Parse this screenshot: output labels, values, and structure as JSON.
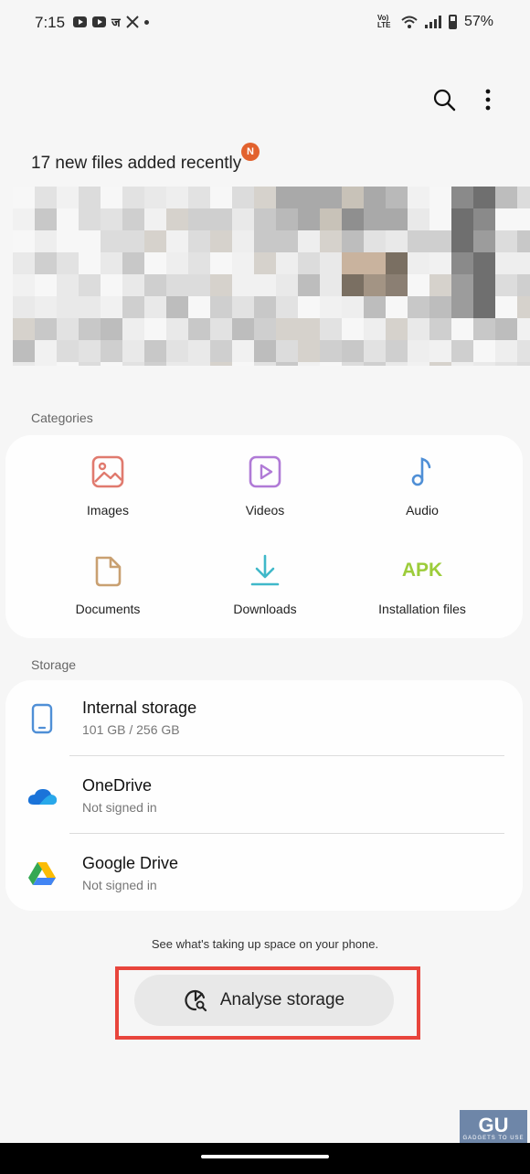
{
  "status_bar": {
    "time": "7:15",
    "battery": "57%",
    "network": "Vo) LTE",
    "app_indicator": "ज"
  },
  "toolbar": {
    "search_icon": "search-icon",
    "more_icon": "more-vertical-icon"
  },
  "recent": {
    "title": "17 new files added recently",
    "badge": "N"
  },
  "categories": {
    "label": "Categories",
    "items": [
      {
        "label": "Images",
        "icon": "image-icon",
        "color": "#e07a6e"
      },
      {
        "label": "Videos",
        "icon": "video-icon",
        "color": "#b07ad6"
      },
      {
        "label": "Audio",
        "icon": "music-note-icon",
        "color": "#4f8fd6"
      },
      {
        "label": "Documents",
        "icon": "document-icon",
        "color": "#c9a071"
      },
      {
        "label": "Downloads",
        "icon": "download-icon",
        "color": "#3fb8c9"
      },
      {
        "label": "Installation files",
        "icon": "apk-icon",
        "icon_text": "APK",
        "color": "#9ccc3a"
      }
    ]
  },
  "storage": {
    "label": "Storage",
    "items": [
      {
        "title": "Internal storage",
        "subtitle": "101 GB / 256 GB",
        "icon": "phone-icon"
      },
      {
        "title": "OneDrive",
        "subtitle": "Not signed in",
        "icon": "onedrive-icon"
      },
      {
        "title": "Google Drive",
        "subtitle": "Not signed in",
        "icon": "google-drive-icon"
      }
    ]
  },
  "analyse": {
    "hint": "See what's taking up space on your phone.",
    "button_label": "Analyse storage"
  },
  "watermark": {
    "big": "GU",
    "small": "GADGETS TO USE"
  }
}
